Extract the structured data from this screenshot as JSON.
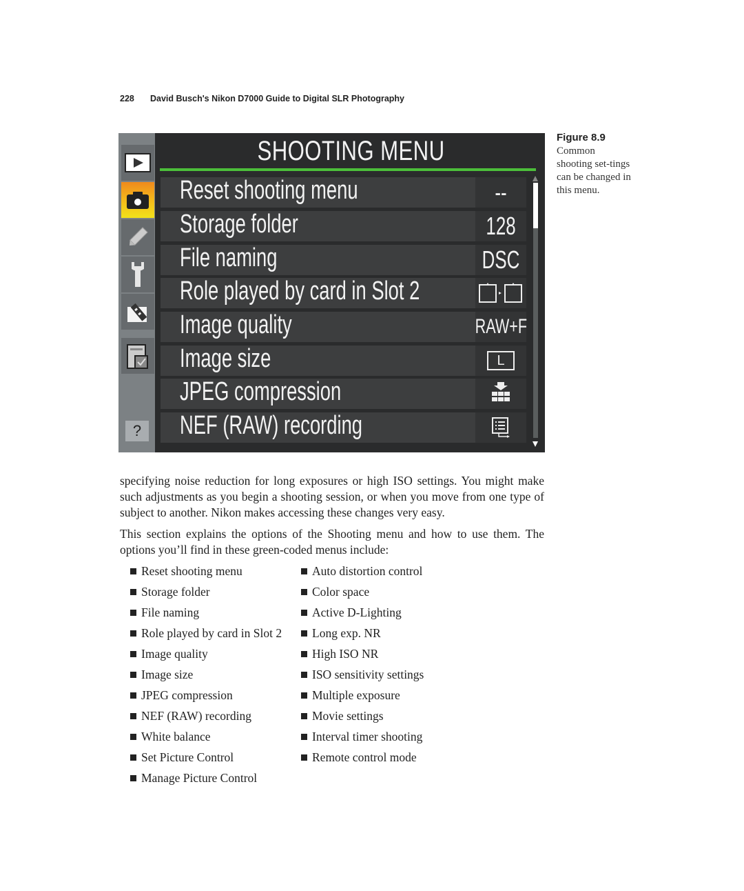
{
  "page_header": {
    "page_number": "228",
    "book_title": "David Busch's Nikon D7000 Guide to Digital SLR Photography"
  },
  "camera_screen": {
    "title": "SHOOTING MENU",
    "accent_color": "#4cbf3a",
    "sidebar": [
      {
        "icon": "playback-icon",
        "active": false
      },
      {
        "icon": "camera-icon",
        "active": true
      },
      {
        "icon": "pencil-icon",
        "active": false
      },
      {
        "icon": "wrench-icon",
        "active": false
      },
      {
        "icon": "retouch-icon",
        "active": false
      },
      {
        "icon": "my-menu-icon",
        "active": false
      }
    ],
    "help_label": "?",
    "items": [
      {
        "label": "Reset shooting menu",
        "value": "--"
      },
      {
        "label": "Storage folder",
        "value": "128"
      },
      {
        "label": "File naming",
        "value": "DSC"
      },
      {
        "label": "Role played by card in Slot 2",
        "value": "slot-overflow-icon"
      },
      {
        "label": "Image quality",
        "value": "RAW+F"
      },
      {
        "label": "Image size",
        "value": "L"
      },
      {
        "label": "JPEG compression",
        "value": "compression-icon"
      },
      {
        "label": "NEF (RAW) recording",
        "value": "nef-recording-icon"
      }
    ]
  },
  "figure": {
    "number": "Figure 8.9",
    "caption": "Common shooting set-tings can be changed in this menu."
  },
  "body": {
    "paragraph1": "specifying noise reduction for long exposures or high ISO settings. You might make such adjustments as you begin a shooting session, or when you move from one type of subject to another. Nikon makes accessing these changes very easy.",
    "paragraph2": "This section explains the options of the Shooting menu and how to use them. The options you’ll find in these green-coded menus include:"
  },
  "bullets_left": [
    "Reset shooting menu",
    "Storage folder",
    "File naming",
    "Role played by card in Slot 2",
    "Image quality",
    "Image size",
    "JPEG compression",
    "NEF (RAW) recording",
    "White balance",
    "Set Picture Control",
    "Manage Picture Control"
  ],
  "bullets_right": [
    "Auto distortion control",
    "Color space",
    "Active D-Lighting",
    "Long exp. NR",
    "High ISO NR",
    "ISO sensitivity settings",
    "Multiple exposure",
    "Movie settings",
    "Interval timer shooting",
    "Remote control mode"
  ]
}
